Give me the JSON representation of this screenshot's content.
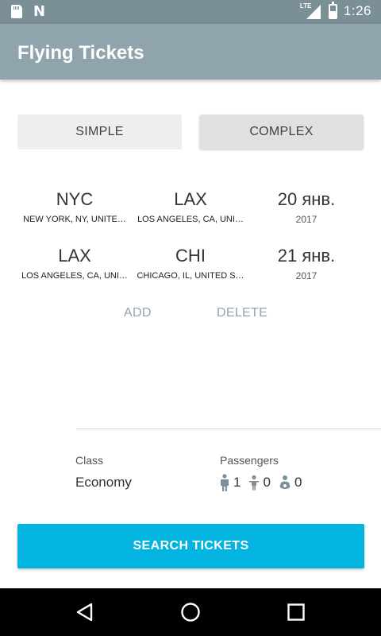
{
  "status_bar": {
    "network_label": "LTE",
    "time": "1:26",
    "icons": [
      "sd-card-icon",
      "n-notification-icon",
      "signal-icon",
      "battery-icon"
    ]
  },
  "app_bar": {
    "title": "Flying Tickets"
  },
  "mode": {
    "simple_label": "SIMPLE",
    "complex_label": "COMPLEX",
    "selected": "COMPLEX"
  },
  "flights": [
    {
      "from_code": "NYC",
      "from_name": "NEW YORK, NY, UNITE…",
      "to_code": "LAX",
      "to_name": "LOS ANGELES, CA, UNI…",
      "date": "20 янв.",
      "year": "2017"
    },
    {
      "from_code": "LAX",
      "from_name": "LOS ANGELES, CA, UNI…",
      "to_code": "CHI",
      "to_name": "CHICAGO, IL, UNITED S…",
      "date": "21 янв.",
      "year": "2017"
    }
  ],
  "actions": {
    "add_label": "ADD",
    "delete_label": "DELETE"
  },
  "class_section": {
    "label": "Class",
    "value": "Economy"
  },
  "passengers_section": {
    "label": "Passengers",
    "adults": "1",
    "children": "0",
    "infants": "0"
  },
  "search": {
    "label": "SEARCH TICKETS"
  },
  "colors": {
    "status_bar": "#7b8f97",
    "app_bar": "#90a4ae",
    "accent": "#03b4e1",
    "text_button": "#90a4ae"
  }
}
